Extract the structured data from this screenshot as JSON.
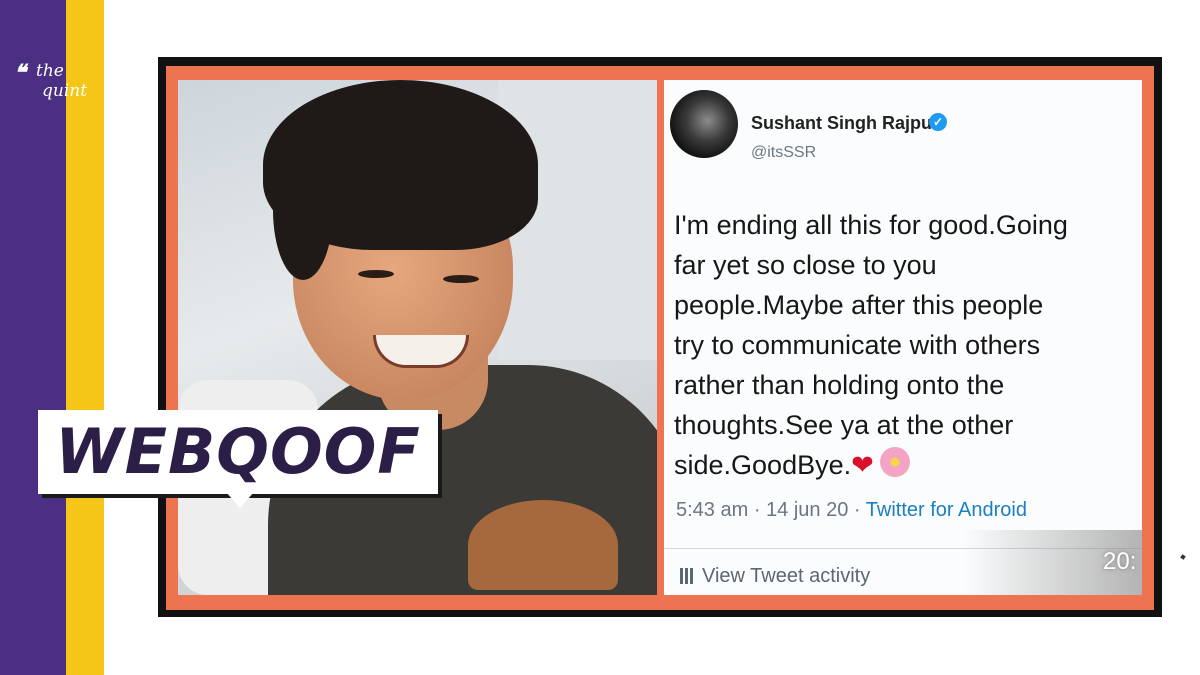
{
  "brand": {
    "logo_quote": "❝",
    "logo_line1": "the",
    "logo_line2": "quint",
    "colors": {
      "purple": "#4a2f82",
      "yellow": "#f5c518",
      "frame": "#ee7350"
    }
  },
  "badge": {
    "label": "WEBQOOF"
  },
  "tweet": {
    "author_name": "Sushant Singh Rajput",
    "verified_mark": "✓",
    "handle": "@itsSSR",
    "lines": [
      "I'm ending all this for good.Going",
      "far yet so close to you",
      "people.Maybe after this people",
      "try to communicate with others",
      "rather than holding onto the",
      "thoughts.See ya at the other",
      "side.GoodBye."
    ],
    "heart": "❤",
    "time": "5:43 am · 14 jun 20 ·",
    "app": "Twitter for Android",
    "activity": "View Tweet activity",
    "video_timestamp": "20:"
  }
}
